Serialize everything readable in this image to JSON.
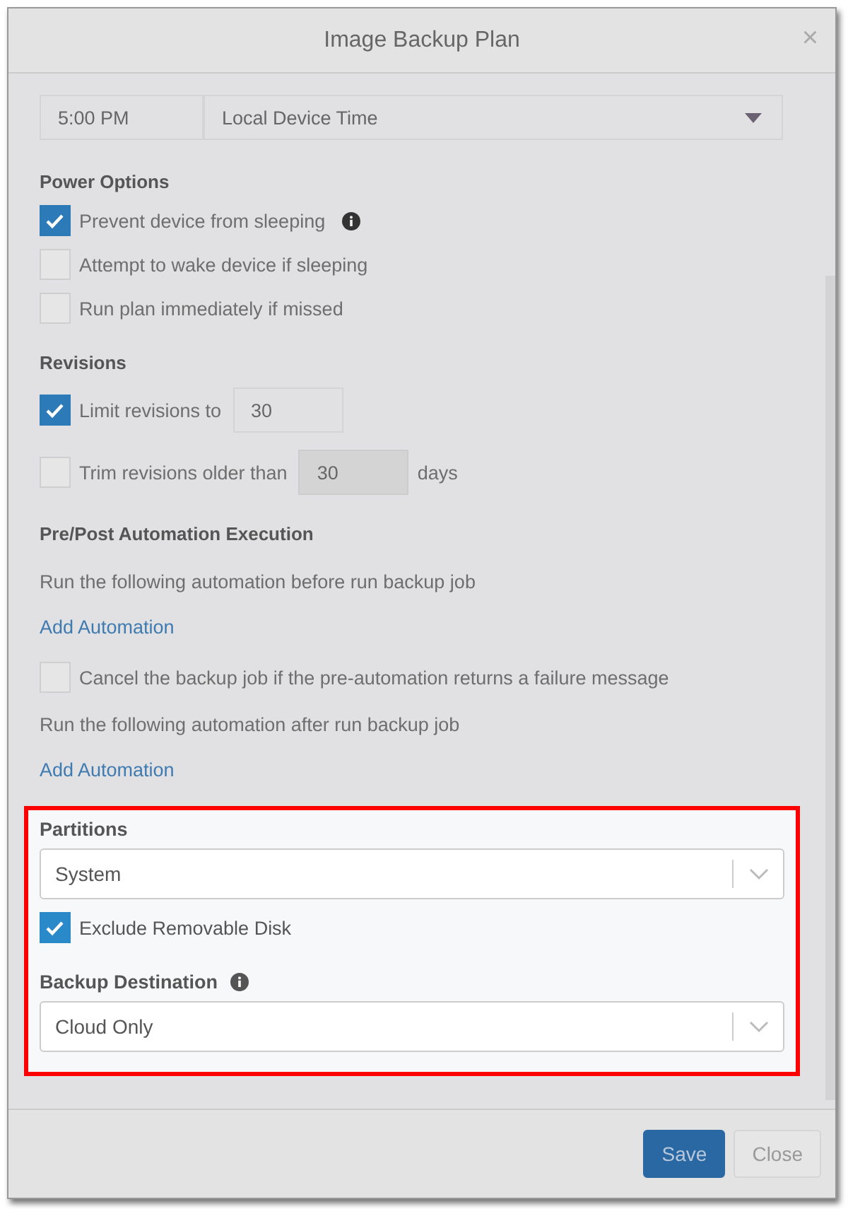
{
  "dialog": {
    "title": "Image Backup Plan",
    "close": "×"
  },
  "time": {
    "value": "5:00 PM",
    "zone": "Local Device Time"
  },
  "power": {
    "heading": "Power Options",
    "options": [
      {
        "label": "Prevent device from sleeping",
        "checked": true,
        "info": true
      },
      {
        "label": "Attempt to wake device if sleeping",
        "checked": false,
        "info": false
      },
      {
        "label": "Run plan immediately if missed",
        "checked": false,
        "info": false
      }
    ]
  },
  "revisions": {
    "heading": "Revisions",
    "rows": [
      {
        "label": "Limit revisions to",
        "checked": true,
        "value": "30",
        "disabled": false
      },
      {
        "label": "Trim revisions older than",
        "checked": false,
        "value": "30",
        "disabled": true,
        "unit": "days"
      }
    ]
  },
  "automation": {
    "heading": "Pre/Post Automation Execution",
    "items": [
      {
        "kind": "text",
        "text": "Run the following automation before run backup job"
      },
      {
        "kind": "link",
        "text": "Add Automation"
      },
      {
        "kind": "checkbox",
        "text": "Cancel the backup job if the pre-automation returns a failure message",
        "checked": false
      },
      {
        "kind": "text",
        "text": "Run the following automation after run backup job"
      },
      {
        "kind": "link",
        "text": "Add Automation"
      }
    ]
  },
  "highlight": {
    "highlighted": true,
    "partitions": {
      "heading": "Partitions",
      "value": "System"
    },
    "exclude": {
      "label": "Exclude Removable Disk",
      "checked": true
    },
    "destination": {
      "heading": "Backup Destination",
      "info": true,
      "value": "Cloud Only"
    }
  },
  "buttons": [
    {
      "label": "Save",
      "kind": "primary"
    },
    {
      "label": "Close",
      "kind": "secondary"
    }
  ]
}
